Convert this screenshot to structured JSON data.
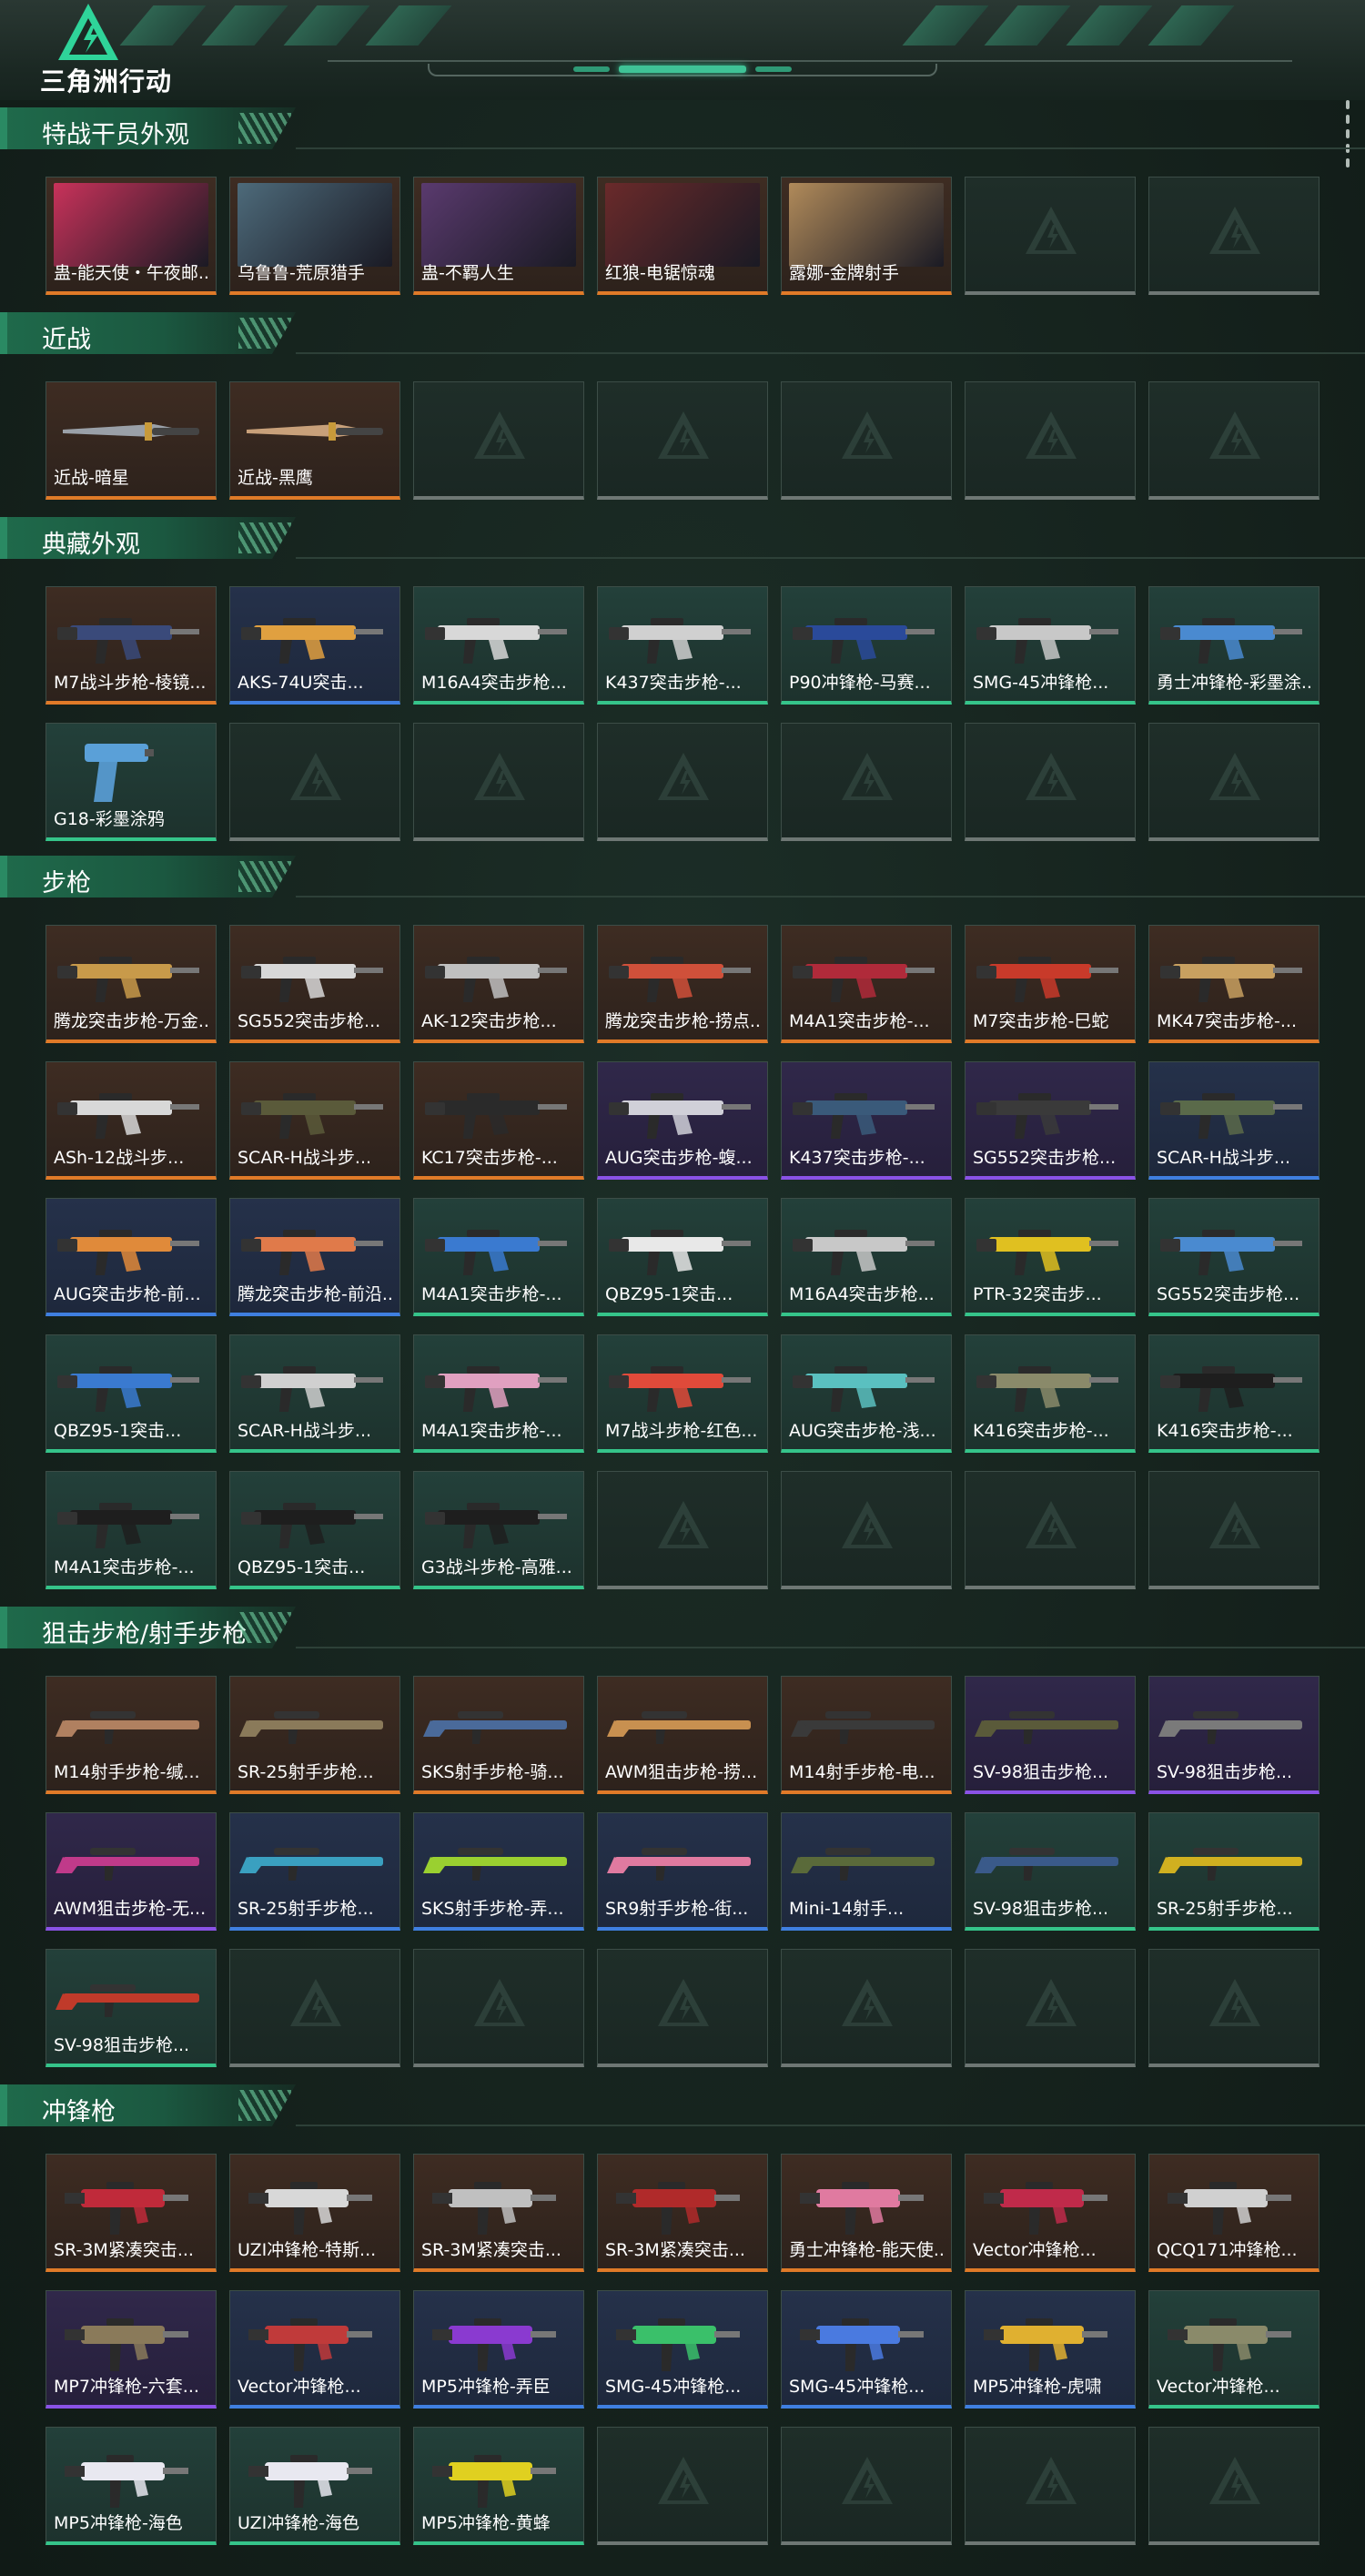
{
  "app": {
    "logo_text": "三角洲行动"
  },
  "sections": [
    {
      "title": "特战干员外观",
      "items": [
        {
          "label": "蛊-能天使・午夜邮...",
          "rarity": "orange",
          "kind": "portrait",
          "color": "#c8325a"
        },
        {
          "label": "乌鲁鲁-荒原猎手",
          "rarity": "orange",
          "kind": "portrait",
          "color": "#4d6a7a"
        },
        {
          "label": "蛊-不羁人生",
          "rarity": "orange",
          "kind": "portrait",
          "color": "#5a3a6e"
        },
        {
          "label": "红狼-电锯惊魂",
          "rarity": "orange",
          "kind": "portrait",
          "color": "#6a2a2a"
        },
        {
          "label": "露娜-金牌射手",
          "rarity": "orange",
          "kind": "portrait",
          "color": "#b08a5a"
        },
        {
          "label": "",
          "rarity": "none",
          "kind": "empty"
        },
        {
          "label": "",
          "rarity": "none",
          "kind": "empty"
        }
      ]
    },
    {
      "title": "近战",
      "items": [
        {
          "label": "近战-暗星",
          "rarity": "orange",
          "kind": "knife",
          "color": "#9aa0a8"
        },
        {
          "label": "近战-黑鹰",
          "rarity": "orange",
          "kind": "knife",
          "color": "#c8a07a"
        },
        {
          "label": "",
          "rarity": "none",
          "kind": "empty"
        },
        {
          "label": "",
          "rarity": "none",
          "kind": "empty"
        },
        {
          "label": "",
          "rarity": "none",
          "kind": "empty"
        },
        {
          "label": "",
          "rarity": "none",
          "kind": "empty"
        },
        {
          "label": "",
          "rarity": "none",
          "kind": "empty"
        }
      ]
    },
    {
      "title": "典藏外观",
      "items": [
        {
          "label": "M7战斗步枪-棱镜...",
          "rarity": "orange",
          "kind": "gun",
          "color": "#3a4a7a"
        },
        {
          "label": "AKS-74U突击...",
          "rarity": "blue",
          "kind": "gun",
          "color": "#e0a040"
        },
        {
          "label": "M16A4突击步枪...",
          "rarity": "green",
          "kind": "gun",
          "color": "#d8d8d8"
        },
        {
          "label": "K437突击步枪-...",
          "rarity": "green",
          "kind": "gun",
          "color": "#d0d0d0"
        },
        {
          "label": "P90冲锋枪-马赛...",
          "rarity": "green",
          "kind": "gun",
          "color": "#2a4a9a"
        },
        {
          "label": "SMG-45冲锋枪...",
          "rarity": "green",
          "kind": "gun",
          "color": "#c8c8c8"
        },
        {
          "label": "勇士冲锋枪-彩墨涂...",
          "rarity": "green",
          "kind": "gun",
          "color": "#4a8ad0"
        },
        {
          "label": "G18-彩墨涂鸦",
          "rarity": "green",
          "kind": "pistol",
          "color": "#5aa0d8"
        },
        {
          "label": "",
          "rarity": "none",
          "kind": "empty"
        },
        {
          "label": "",
          "rarity": "none",
          "kind": "empty"
        },
        {
          "label": "",
          "rarity": "none",
          "kind": "empty"
        },
        {
          "label": "",
          "rarity": "none",
          "kind": "empty"
        },
        {
          "label": "",
          "rarity": "none",
          "kind": "empty"
        },
        {
          "label": "",
          "rarity": "none",
          "kind": "empty"
        }
      ]
    },
    {
      "title": "步枪",
      "items": [
        {
          "label": "腾龙突击步枪-万金...",
          "rarity": "orange",
          "kind": "gun",
          "color": "#c89a4a"
        },
        {
          "label": "SG552突击步枪...",
          "rarity": "orange",
          "kind": "gun",
          "color": "#d8d8d8"
        },
        {
          "label": "AK-12突击步枪...",
          "rarity": "orange",
          "kind": "gun",
          "color": "#c0c0c0"
        },
        {
          "label": "腾龙突击步枪-捞点...",
          "rarity": "orange",
          "kind": "gun",
          "color": "#d0503a"
        },
        {
          "label": "M4A1突击步枪-...",
          "rarity": "orange",
          "kind": "gun",
          "color": "#b02a3a"
        },
        {
          "label": "M7突击步枪-巳蛇",
          "rarity": "orange",
          "kind": "gun",
          "color": "#c83a2a"
        },
        {
          "label": "MK47突击步枪-...",
          "rarity": "orange",
          "kind": "gun",
          "color": "#c8a060"
        },
        {
          "label": "ASh-12战斗步...",
          "rarity": "orange",
          "kind": "gun",
          "color": "#d8d8d8"
        },
        {
          "label": "SCAR-H战斗步...",
          "rarity": "orange",
          "kind": "gun",
          "color": "#5a5a3a"
        },
        {
          "label": "KC17突击步枪-...",
          "rarity": "orange",
          "kind": "gun",
          "color": "#2a2a2a"
        },
        {
          "label": "AUG突击步枪-蝮...",
          "rarity": "purple",
          "kind": "gun",
          "color": "#d0d0d8"
        },
        {
          "label": "K437突击步枪-...",
          "rarity": "purple",
          "kind": "gun",
          "color": "#3a5a7a"
        },
        {
          "label": "SG552突击步枪...",
          "rarity": "purple",
          "kind": "gun",
          "color": "#3a3a3a"
        },
        {
          "label": "SCAR-H战斗步...",
          "rarity": "blue",
          "kind": "gun",
          "color": "#5a6a4a"
        },
        {
          "label": "AUG突击步枪-前...",
          "rarity": "blue",
          "kind": "gun",
          "color": "#e08a3a"
        },
        {
          "label": "腾龙突击步枪-前沿...",
          "rarity": "blue",
          "kind": "gun",
          "color": "#e07a4a"
        },
        {
          "label": "M4A1突击步枪-...",
          "rarity": "green",
          "kind": "gun",
          "color": "#3a7ad0"
        },
        {
          "label": "QBZ95-1突击...",
          "rarity": "green",
          "kind": "gun",
          "color": "#e8e8e8"
        },
        {
          "label": "M16A4突击步枪...",
          "rarity": "green",
          "kind": "gun",
          "color": "#c8c8c8"
        },
        {
          "label": "PTR-32突击步...",
          "rarity": "green",
          "kind": "gun",
          "color": "#e0c020"
        },
        {
          "label": "SG552突击步枪...",
          "rarity": "green",
          "kind": "gun",
          "color": "#4a8ad0"
        },
        {
          "label": "QBZ95-1突击...",
          "rarity": "green",
          "kind": "gun",
          "color": "#3a7ad0"
        },
        {
          "label": "SCAR-H战斗步...",
          "rarity": "green",
          "kind": "gun",
          "color": "#d0d0d0"
        },
        {
          "label": "M4A1突击步枪-...",
          "rarity": "green",
          "kind": "gun",
          "color": "#e0a0c0"
        },
        {
          "label": "M7战斗步枪-红色...",
          "rarity": "green",
          "kind": "gun",
          "color": "#e04a3a"
        },
        {
          "label": "AUG突击步枪-浅...",
          "rarity": "green",
          "kind": "gun",
          "color": "#5ac0c0"
        },
        {
          "label": "K416突击步枪-...",
          "rarity": "green",
          "kind": "gun",
          "color": "#8a8a6a"
        },
        {
          "label": "K416突击步枪-...",
          "rarity": "green",
          "kind": "gun",
          "color": "#1e1e1e"
        },
        {
          "label": "M4A1突击步枪-...",
          "rarity": "green",
          "kind": "gun",
          "color": "#1e1e1e"
        },
        {
          "label": "QBZ95-1突击...",
          "rarity": "green",
          "kind": "gun",
          "color": "#1e1e1e"
        },
        {
          "label": "G3战斗步枪-高雅...",
          "rarity": "green",
          "kind": "gun",
          "color": "#1e1e1e"
        },
        {
          "label": "",
          "rarity": "none",
          "kind": "empty"
        },
        {
          "label": "",
          "rarity": "none",
          "kind": "empty"
        },
        {
          "label": "",
          "rarity": "none",
          "kind": "empty"
        },
        {
          "label": "",
          "rarity": "none",
          "kind": "empty"
        }
      ]
    },
    {
      "title": "狙击步枪/射手步枪",
      "items": [
        {
          "label": "M14射手步枪-缄...",
          "rarity": "orange",
          "kind": "sniper",
          "color": "#b08060"
        },
        {
          "label": "SR-25射手步枪...",
          "rarity": "orange",
          "kind": "sniper",
          "color": "#8a7a5a"
        },
        {
          "label": "SKS射手步枪-骑...",
          "rarity": "orange",
          "kind": "sniper",
          "color": "#4a6a9a"
        },
        {
          "label": "AWM狙击步枪-捞...",
          "rarity": "orange",
          "kind": "sniper",
          "color": "#c89050"
        },
        {
          "label": "M14射手步枪-电...",
          "rarity": "orange",
          "kind": "sniper",
          "color": "#3a3a3a"
        },
        {
          "label": "SV-98狙击步枪...",
          "rarity": "purple",
          "kind": "sniper",
          "color": "#5a5a3a"
        },
        {
          "label": "SV-98狙击步枪...",
          "rarity": "purple",
          "kind": "sniper",
          "color": "#7a7a7a"
        },
        {
          "label": "AWM狙击步枪-无...",
          "rarity": "purple",
          "kind": "sniper",
          "color": "#c03a8a"
        },
        {
          "label": "SR-25射手步枪...",
          "rarity": "blue",
          "kind": "sniper",
          "color": "#3aa0c0"
        },
        {
          "label": "SKS射手步枪-弄...",
          "rarity": "blue",
          "kind": "sniper",
          "color": "#9ad030"
        },
        {
          "label": "SR9射手步枪-街...",
          "rarity": "blue",
          "kind": "sniper",
          "color": "#e07aa0"
        },
        {
          "label": "Mini-14射手...",
          "rarity": "blue",
          "kind": "sniper",
          "color": "#5a6a3a"
        },
        {
          "label": "SV-98狙击步枪...",
          "rarity": "green",
          "kind": "sniper",
          "color": "#3a5a8a"
        },
        {
          "label": "SR-25射手步枪...",
          "rarity": "green",
          "kind": "sniper",
          "color": "#d0b020"
        },
        {
          "label": "SV-98狙击步枪...",
          "rarity": "green",
          "kind": "sniper",
          "color": "#c03a2a"
        },
        {
          "label": "",
          "rarity": "none",
          "kind": "empty"
        },
        {
          "label": "",
          "rarity": "none",
          "kind": "empty"
        },
        {
          "label": "",
          "rarity": "none",
          "kind": "empty"
        },
        {
          "label": "",
          "rarity": "none",
          "kind": "empty"
        },
        {
          "label": "",
          "rarity": "none",
          "kind": "empty"
        },
        {
          "label": "",
          "rarity": "none",
          "kind": "empty"
        }
      ]
    },
    {
      "title": "冲锋枪",
      "items": [
        {
          "label": "SR-3M紧凑突击...",
          "rarity": "orange",
          "kind": "smg",
          "color": "#c02a3a"
        },
        {
          "label": "UZI冲锋枪-特斯...",
          "rarity": "orange",
          "kind": "smg",
          "color": "#d8d8d8"
        },
        {
          "label": "SR-3M紧凑突击...",
          "rarity": "orange",
          "kind": "smg",
          "color": "#c0c0c0"
        },
        {
          "label": "SR-3M紧凑突击...",
          "rarity": "orange",
          "kind": "smg",
          "color": "#b02a2a"
        },
        {
          "label": "勇士冲锋枪-能天使...",
          "rarity": "orange",
          "kind": "smg",
          "color": "#e07aa0"
        },
        {
          "label": "Vector冲锋枪...",
          "rarity": "orange",
          "kind": "smg",
          "color": "#c02a4a"
        },
        {
          "label": "QCQ171冲锋枪...",
          "rarity": "orange",
          "kind": "smg",
          "color": "#d0d0d0"
        },
        {
          "label": "MP7冲锋枪-六套...",
          "rarity": "purple",
          "kind": "smg",
          "color": "#8a7a5a"
        },
        {
          "label": "Vector冲锋枪...",
          "rarity": "blue",
          "kind": "smg",
          "color": "#c03a3a"
        },
        {
          "label": "MP5冲锋枪-弄臣",
          "rarity": "blue",
          "kind": "smg",
          "color": "#8a3ad0"
        },
        {
          "label": "SMG-45冲锋枪...",
          "rarity": "blue",
          "kind": "smg",
          "color": "#3ac06a"
        },
        {
          "label": "SMG-45冲锋枪...",
          "rarity": "blue",
          "kind": "smg",
          "color": "#4a7ae0"
        },
        {
          "label": "MP5冲锋枪-虎啸",
          "rarity": "blue",
          "kind": "smg",
          "color": "#e0b030"
        },
        {
          "label": "Vector冲锋枪...",
          "rarity": "green",
          "kind": "smg",
          "color": "#8a8a6a"
        },
        {
          "label": "MP5冲锋枪-海色",
          "rarity": "green",
          "kind": "smg",
          "color": "#e8e8f0"
        },
        {
          "label": "UZI冲锋枪-海色",
          "rarity": "green",
          "kind": "smg",
          "color": "#e8e8f0"
        },
        {
          "label": "MP5冲锋枪-黄蜂",
          "rarity": "green",
          "kind": "smg",
          "color": "#e0d020"
        },
        {
          "label": "",
          "rarity": "none",
          "kind": "empty"
        },
        {
          "label": "",
          "rarity": "none",
          "kind": "empty"
        },
        {
          "label": "",
          "rarity": "none",
          "kind": "empty"
        },
        {
          "label": "",
          "rarity": "none",
          "kind": "empty"
        }
      ]
    }
  ]
}
